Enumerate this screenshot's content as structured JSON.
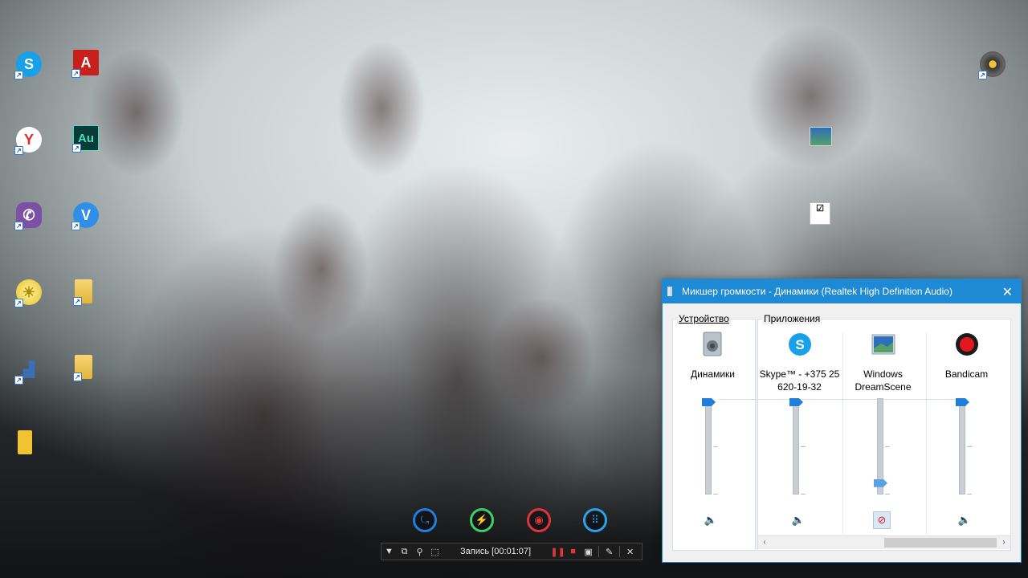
{
  "desktop": {
    "icons": [
      {
        "id": "skype",
        "glyph": "S",
        "color": "#18a0e8"
      },
      {
        "id": "adobe-acrobat",
        "glyph": "A",
        "color": "#c8201c"
      },
      {
        "id": "yandex",
        "glyph": "Y",
        "color": "#ffffff"
      },
      {
        "id": "adobe-audition",
        "glyph": "Au",
        "color": "#0b3b36"
      },
      {
        "id": "viber",
        "glyph": "✆",
        "color": "#7b51a5"
      },
      {
        "id": "v-app",
        "glyph": "V",
        "color": "#2f8fe8"
      },
      {
        "id": "sun-app",
        "glyph": "☀",
        "color": "#e7c128"
      },
      {
        "id": "folder",
        "glyph": "",
        "color": "#e9c04c"
      },
      {
        "id": "stairs-app",
        "glyph": "▟",
        "color": "#3b6fb5"
      },
      {
        "id": "folder",
        "glyph": "",
        "color": "#e9c04c"
      },
      {
        "id": "file",
        "glyph": "",
        "color": "#f1c232"
      }
    ]
  },
  "bandicam": {
    "status_text": "Запись [00:01:07]",
    "modes": [
      "device-mode",
      "game-mode",
      "screen-mode",
      "webcam-mode"
    ]
  },
  "mixer": {
    "title": "Микшер громкости - Динамики (Realtek High Definition Audio)",
    "close_glyph": "✕",
    "device_group_label": "Устройство",
    "apps_group_label": "Приложения",
    "channels": [
      {
        "name": "Динамики",
        "icon": "speaker-device-icon",
        "volume": 100,
        "muted": false
      },
      {
        "name": "Skype™ - +375 25 620-19-32",
        "icon": "skype-icon",
        "volume": 100,
        "muted": false
      },
      {
        "name": "Windows DreamScene",
        "icon": "dreamscene-icon",
        "volume": 10,
        "muted": true
      },
      {
        "name": "Bandicam",
        "icon": "bandicam-record-icon",
        "volume": 100,
        "muted": false
      }
    ],
    "scroll_left": "‹",
    "scroll_right": "›"
  }
}
